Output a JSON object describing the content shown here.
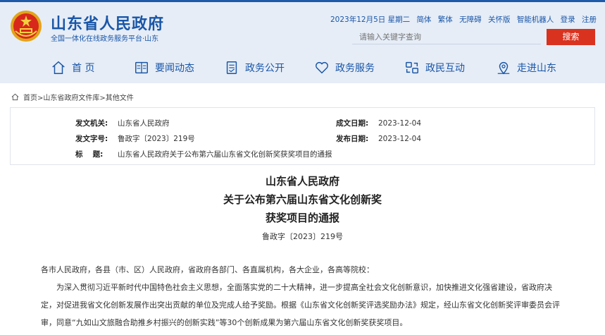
{
  "header": {
    "title": "山东省人民政府",
    "subtitle": "全国一体化在线政务服务平台·山东",
    "date": "2023年12月5日 星期二",
    "links": [
      "简体",
      "繁体",
      "无障碍",
      "关怀版",
      "智能机器人",
      "登录",
      "注册"
    ],
    "search_placeholder": "请输入关键字查询",
    "search_button": "搜索"
  },
  "nav": {
    "items": [
      {
        "label": "首 页",
        "icon": "home-icon"
      },
      {
        "label": "要闻动态",
        "icon": "news-icon"
      },
      {
        "label": "政务公开",
        "icon": "document-icon"
      },
      {
        "label": "政务服务",
        "icon": "heart-icon"
      },
      {
        "label": "政民互动",
        "icon": "interaction-icon"
      },
      {
        "label": "走进山东",
        "icon": "location-icon"
      }
    ]
  },
  "breadcrumb": "首页>山东省政府文件库>其他文件",
  "meta": {
    "issuer_label": "发文机关:",
    "issuer": "山东省人民政府",
    "number_label": "发文字号:",
    "number": "鲁政字〔2023〕219号",
    "title_label": "标　  题:",
    "title": "山东省人民政府关于公布第六届山东省文化创新奖获奖项目的通报",
    "created_label": "成文日期:",
    "created": "2023-12-04",
    "published_label": "发布日期:",
    "published": "2023-12-04"
  },
  "document": {
    "title_lines": [
      "山东省人民政府",
      "关于公布第六届山东省文化创新奖",
      "获奖项目的通报"
    ],
    "doc_number": "鲁政字〔2023〕219号",
    "paragraphs": [
      "各市人民政府，各县（市、区）人民政府，省政府各部门、各直属机构，各大企业，各高等院校：",
      "　　为深入贯彻习近平新时代中国特色社会主义思想，全面落实党的二十大精神，进一步提高全社会文化创新意识，加快推进文化强省建设，省政府决",
      "定，对促进我省文化创新发展作出突出贡献的单位及完成人给予奖励。根据《山东省文化创新奖评选奖励办法》规定，经山东省文化创新奖评审委员会评",
      "审，同意“九如山文旅融合助推乡村振兴的创新实践”等30个创新成果为第六届山东省文化创新奖获奖项目。"
    ]
  },
  "colors": {
    "primary": "#1a56a7",
    "search_button": "#d9321f",
    "header_bg": "#e6edf7"
  }
}
